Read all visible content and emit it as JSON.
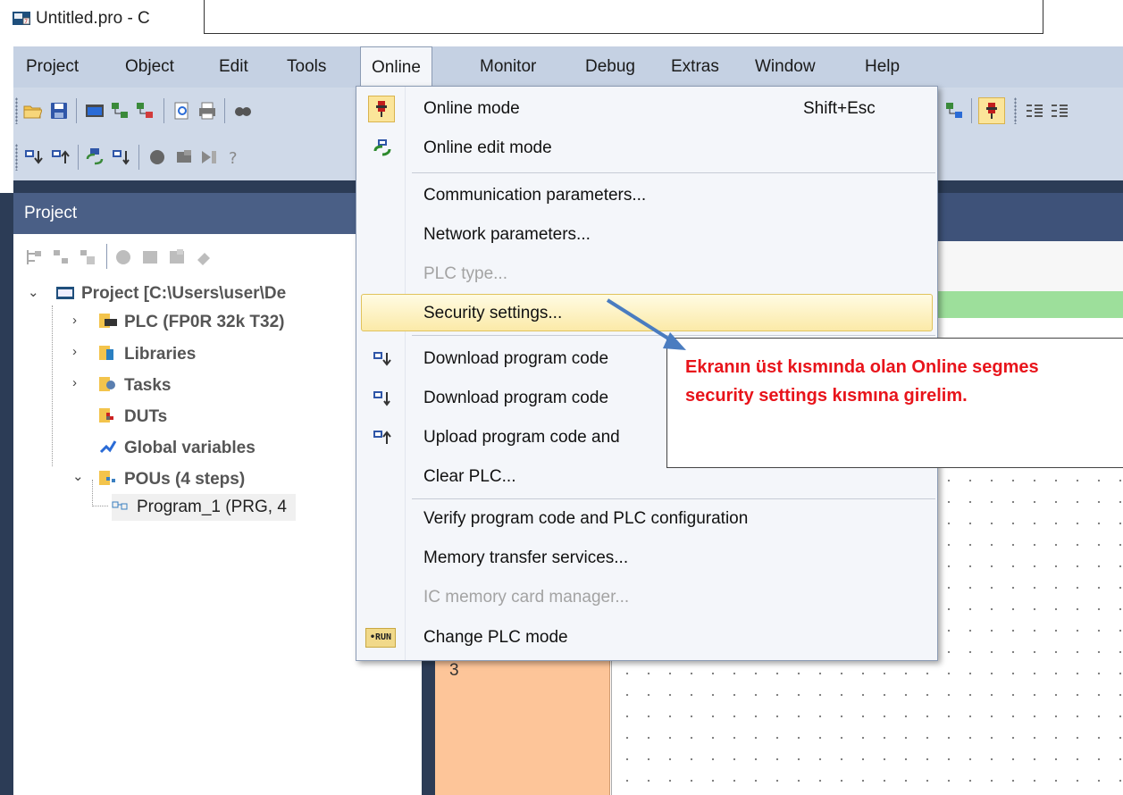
{
  "window": {
    "title": "Untitled.pro - C"
  },
  "menubar": {
    "items": [
      "Project",
      "Object",
      "Edit",
      "Tools",
      "Online",
      "Monitor",
      "Debug",
      "Extras",
      "Window",
      "Help"
    ]
  },
  "project_panel": {
    "title": "Project",
    "tree": [
      {
        "label": "Project [C:\\Users\\user\\De"
      },
      {
        "label": "PLC (FP0R 32k T32)"
      },
      {
        "label": "Libraries"
      },
      {
        "label": "Tasks"
      },
      {
        "label": "DUTs"
      },
      {
        "label": "Global variables"
      },
      {
        "label": "POUs (4 steps)"
      },
      {
        "label": "Program_1 (PRG, 4"
      }
    ]
  },
  "editor": {
    "line_number": "3"
  },
  "online_menu": {
    "items": [
      {
        "label": "Online mode",
        "shortcut": "Shift+Esc",
        "icon": "online-mode-plug-icon",
        "enabled": true
      },
      {
        "label": "Online edit mode",
        "icon": "online-edit-icon",
        "enabled": true
      },
      {
        "label": "Communication parameters...",
        "enabled": true
      },
      {
        "label": "Network parameters...",
        "enabled": true
      },
      {
        "label": "PLC type...",
        "enabled": false
      },
      {
        "label": "Security settings...",
        "enabled": true,
        "highlighted": true
      },
      {
        "label": "Download program code",
        "icon": "download-icon",
        "enabled": true
      },
      {
        "label": "Download program code",
        "icon": "download-changes-icon",
        "enabled": true
      },
      {
        "label": "Upload program code and",
        "icon": "upload-icon",
        "enabled": true
      },
      {
        "label": "Clear PLC...",
        "enabled": true
      },
      {
        "label": "Verify program code and PLC configuration",
        "enabled": true
      },
      {
        "label": "Memory transfer services...",
        "enabled": true
      },
      {
        "label": "IC memory card manager...",
        "enabled": false
      },
      {
        "label": "Change PLC mode",
        "icon": "run-mode-icon",
        "icon_text": "•RUN",
        "enabled": true
      }
    ]
  },
  "annotation": {
    "line1": "Ekranın üst kısmında olan Online segmes",
    "line2": "security settings kısmına  girelim.",
    "color": "#e8141b"
  },
  "colors": {
    "menubar_bg": "#c5d1e3",
    "panel_header": "#4a5f86",
    "highlight": "#fbeaa8",
    "line_column": "#fdc599"
  }
}
